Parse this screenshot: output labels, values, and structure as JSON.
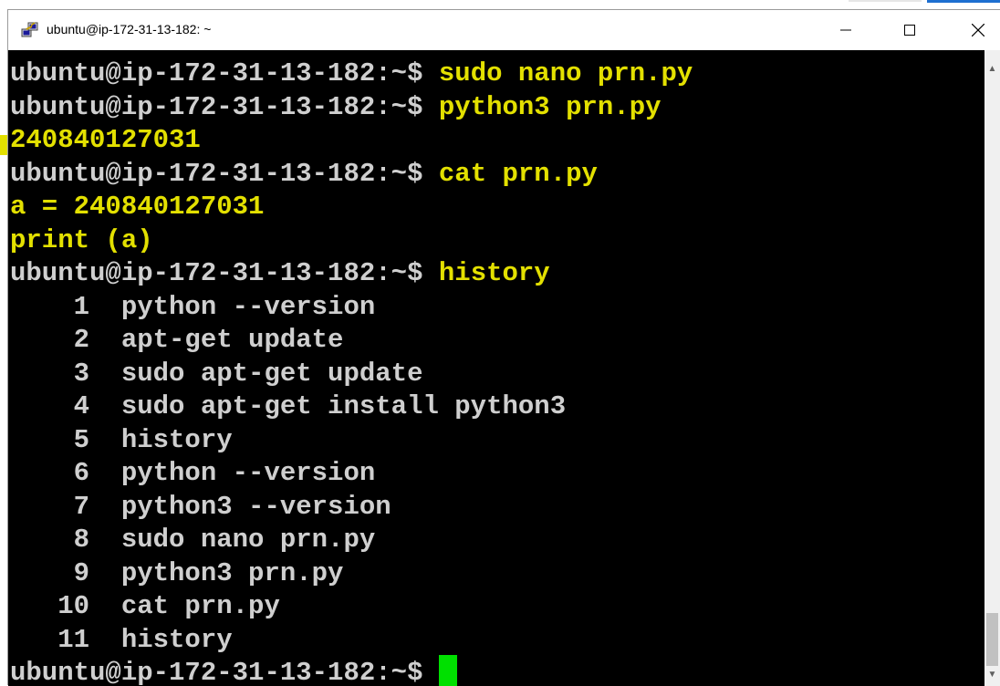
{
  "window": {
    "title": "ubuntu@ip-172-31-13-182: ~",
    "controls": {
      "minimize": "—",
      "maximize": "☐",
      "close": "✕"
    }
  },
  "colors": {
    "background": "#000000",
    "prompt": "#cfcfcf",
    "command": "#e3e000",
    "cursor": "#00e000"
  },
  "terminal": {
    "lines": [
      {
        "prompt": "ubuntu@ip-172-31-13-182:~$ ",
        "command": "sudo nano prn.py"
      },
      {
        "prompt": "ubuntu@ip-172-31-13-182:~$ ",
        "command": "python3 prn.py"
      },
      {
        "prompt": "",
        "command": "240840127031"
      },
      {
        "prompt": "ubuntu@ip-172-31-13-182:~$ ",
        "command": "cat prn.py"
      },
      {
        "prompt": "",
        "command": "a = 240840127031"
      },
      {
        "prompt": "",
        "command": "print (a)"
      },
      {
        "prompt": "ubuntu@ip-172-31-13-182:~$ ",
        "command": "history"
      },
      {
        "prompt": "    1  python --version",
        "command": ""
      },
      {
        "prompt": "    2  apt-get update",
        "command": ""
      },
      {
        "prompt": "    3  sudo apt-get update",
        "command": ""
      },
      {
        "prompt": "    4  sudo apt-get install python3",
        "command": ""
      },
      {
        "prompt": "    5  history",
        "command": ""
      },
      {
        "prompt": "    6  python --version",
        "command": ""
      },
      {
        "prompt": "    7  python3 --version",
        "command": ""
      },
      {
        "prompt": "    8  sudo nano prn.py",
        "command": ""
      },
      {
        "prompt": "    9  python3 prn.py",
        "command": ""
      },
      {
        "prompt": "   10  cat prn.py",
        "command": ""
      },
      {
        "prompt": "   11  history",
        "command": ""
      },
      {
        "prompt": "ubuntu@ip-172-31-13-182:~$ ",
        "command": ""
      }
    ]
  }
}
